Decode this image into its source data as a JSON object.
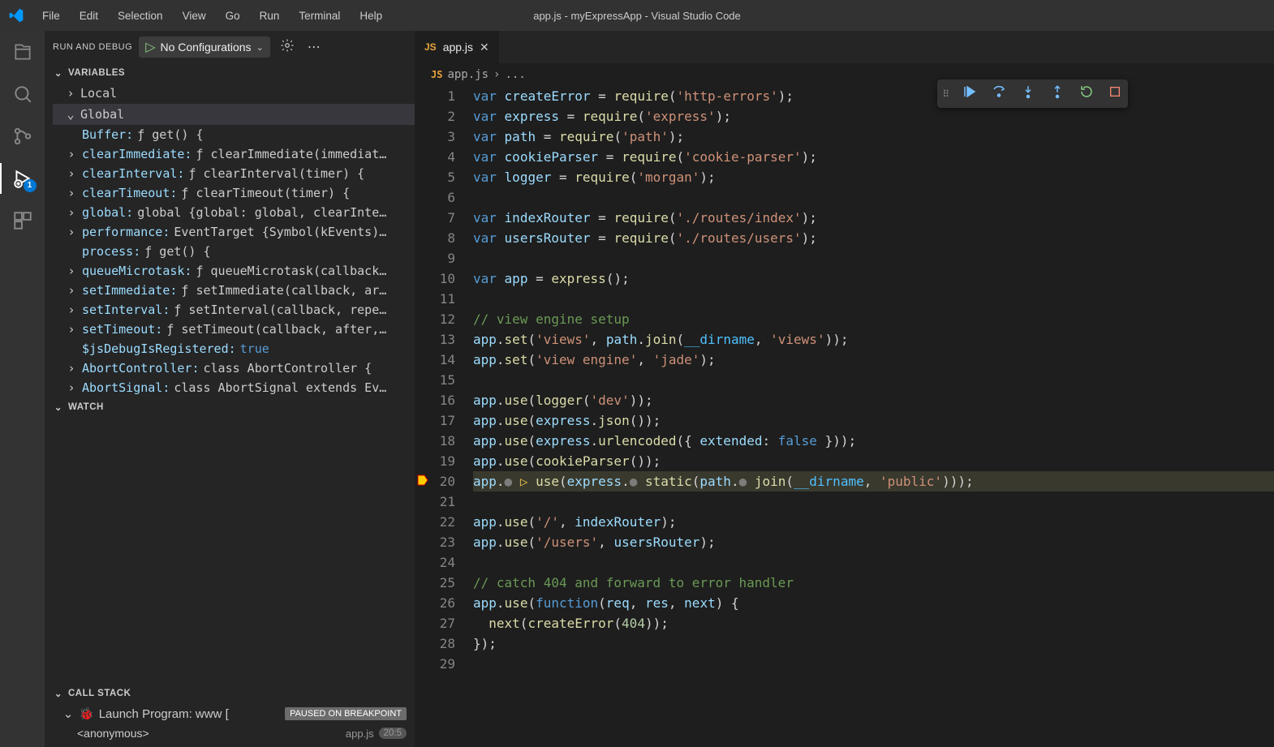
{
  "title": "app.js - myExpressApp - Visual Studio Code",
  "menu": [
    "File",
    "Edit",
    "Selection",
    "View",
    "Go",
    "Run",
    "Terminal",
    "Help"
  ],
  "sidebar": {
    "title": "RUN AND DEBUG",
    "config": "No Configurations",
    "sections": {
      "variables": "VARIABLES",
      "watch": "WATCH",
      "callstack": "CALL STACK"
    },
    "scopes": {
      "local": "Local",
      "global": "Global"
    },
    "globals": [
      {
        "arrow": false,
        "name": "Buffer:",
        "val": "ƒ get() {"
      },
      {
        "arrow": true,
        "name": "clearImmediate:",
        "val": "ƒ clearImmediate(immediat…"
      },
      {
        "arrow": true,
        "name": "clearInterval:",
        "val": "ƒ clearInterval(timer) {"
      },
      {
        "arrow": true,
        "name": "clearTimeout:",
        "val": "ƒ clearTimeout(timer) {"
      },
      {
        "arrow": true,
        "name": "global:",
        "val": "global {global: global, clearInte…"
      },
      {
        "arrow": true,
        "name": "performance:",
        "val": "EventTarget {Symbol(kEvents)…"
      },
      {
        "arrow": false,
        "name": "process:",
        "val": "ƒ get() {"
      },
      {
        "arrow": true,
        "name": "queueMicrotask:",
        "val": "ƒ queueMicrotask(callback…"
      },
      {
        "arrow": true,
        "name": "setImmediate:",
        "val": "ƒ setImmediate(callback, ar…"
      },
      {
        "arrow": true,
        "name": "setInterval:",
        "val": "ƒ setInterval(callback, repe…"
      },
      {
        "arrow": true,
        "name": "setTimeout:",
        "val": "ƒ setTimeout(callback, after,…"
      },
      {
        "arrow": false,
        "name": "$jsDebugIsRegistered:",
        "val": "true",
        "special": true
      },
      {
        "arrow": true,
        "name": "AbortController:",
        "val": "class AbortController {"
      },
      {
        "arrow": true,
        "name": "AbortSignal:",
        "val": "class AbortSignal extends Ev…"
      }
    ],
    "callstack": {
      "program": "Launch Program: www [",
      "status": "PAUSED ON BREAKPOINT",
      "frame": "<anonymous>",
      "file": "app.js",
      "line": "20:5"
    }
  },
  "tabs": {
    "active": "app.js"
  },
  "breadcrumb": {
    "file": "app.js",
    "sep": "›",
    "rest": "..."
  },
  "debug_badge": "1",
  "code": {
    "lines": 29,
    "current": 20
  }
}
